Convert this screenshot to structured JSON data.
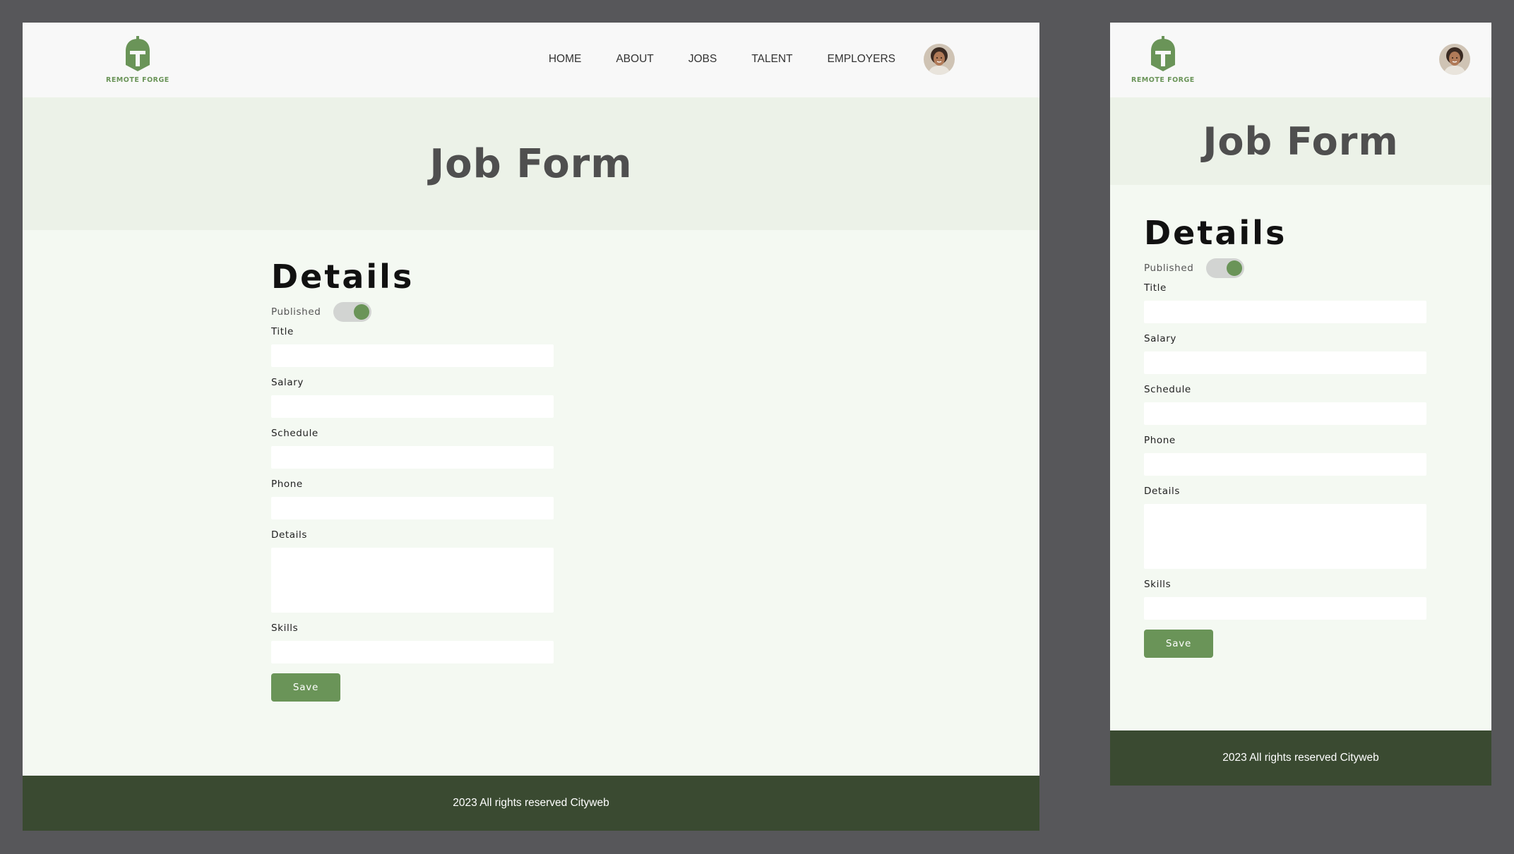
{
  "brand": {
    "name": "REMOTE FORGE",
    "color": "#6a9458"
  },
  "nav": {
    "items": [
      {
        "label": "HOME"
      },
      {
        "label": "ABOUT"
      },
      {
        "label": "JOBS"
      },
      {
        "label": "TALENT"
      },
      {
        "label": "EMPLOYERS"
      }
    ],
    "avatar_icon": "user-avatar"
  },
  "hero": {
    "title": "Job Form"
  },
  "form": {
    "heading": "Details",
    "published_label": "Published",
    "published": true,
    "fields": {
      "title": {
        "label": "Title",
        "value": ""
      },
      "salary": {
        "label": "Salary",
        "value": ""
      },
      "schedule": {
        "label": "Schedule",
        "value": ""
      },
      "phone": {
        "label": "Phone",
        "value": ""
      },
      "details": {
        "label": "Details",
        "value": ""
      },
      "skills": {
        "label": "Skills",
        "value": ""
      }
    },
    "save_label": "Save"
  },
  "footer": {
    "text": "2023 All rights reserved Cityweb"
  },
  "colors": {
    "accent": "#6a9458",
    "hero_bg": "#ecf2e8",
    "page_bg": "#f4f9f2",
    "footer_bg": "#3a4a31"
  }
}
